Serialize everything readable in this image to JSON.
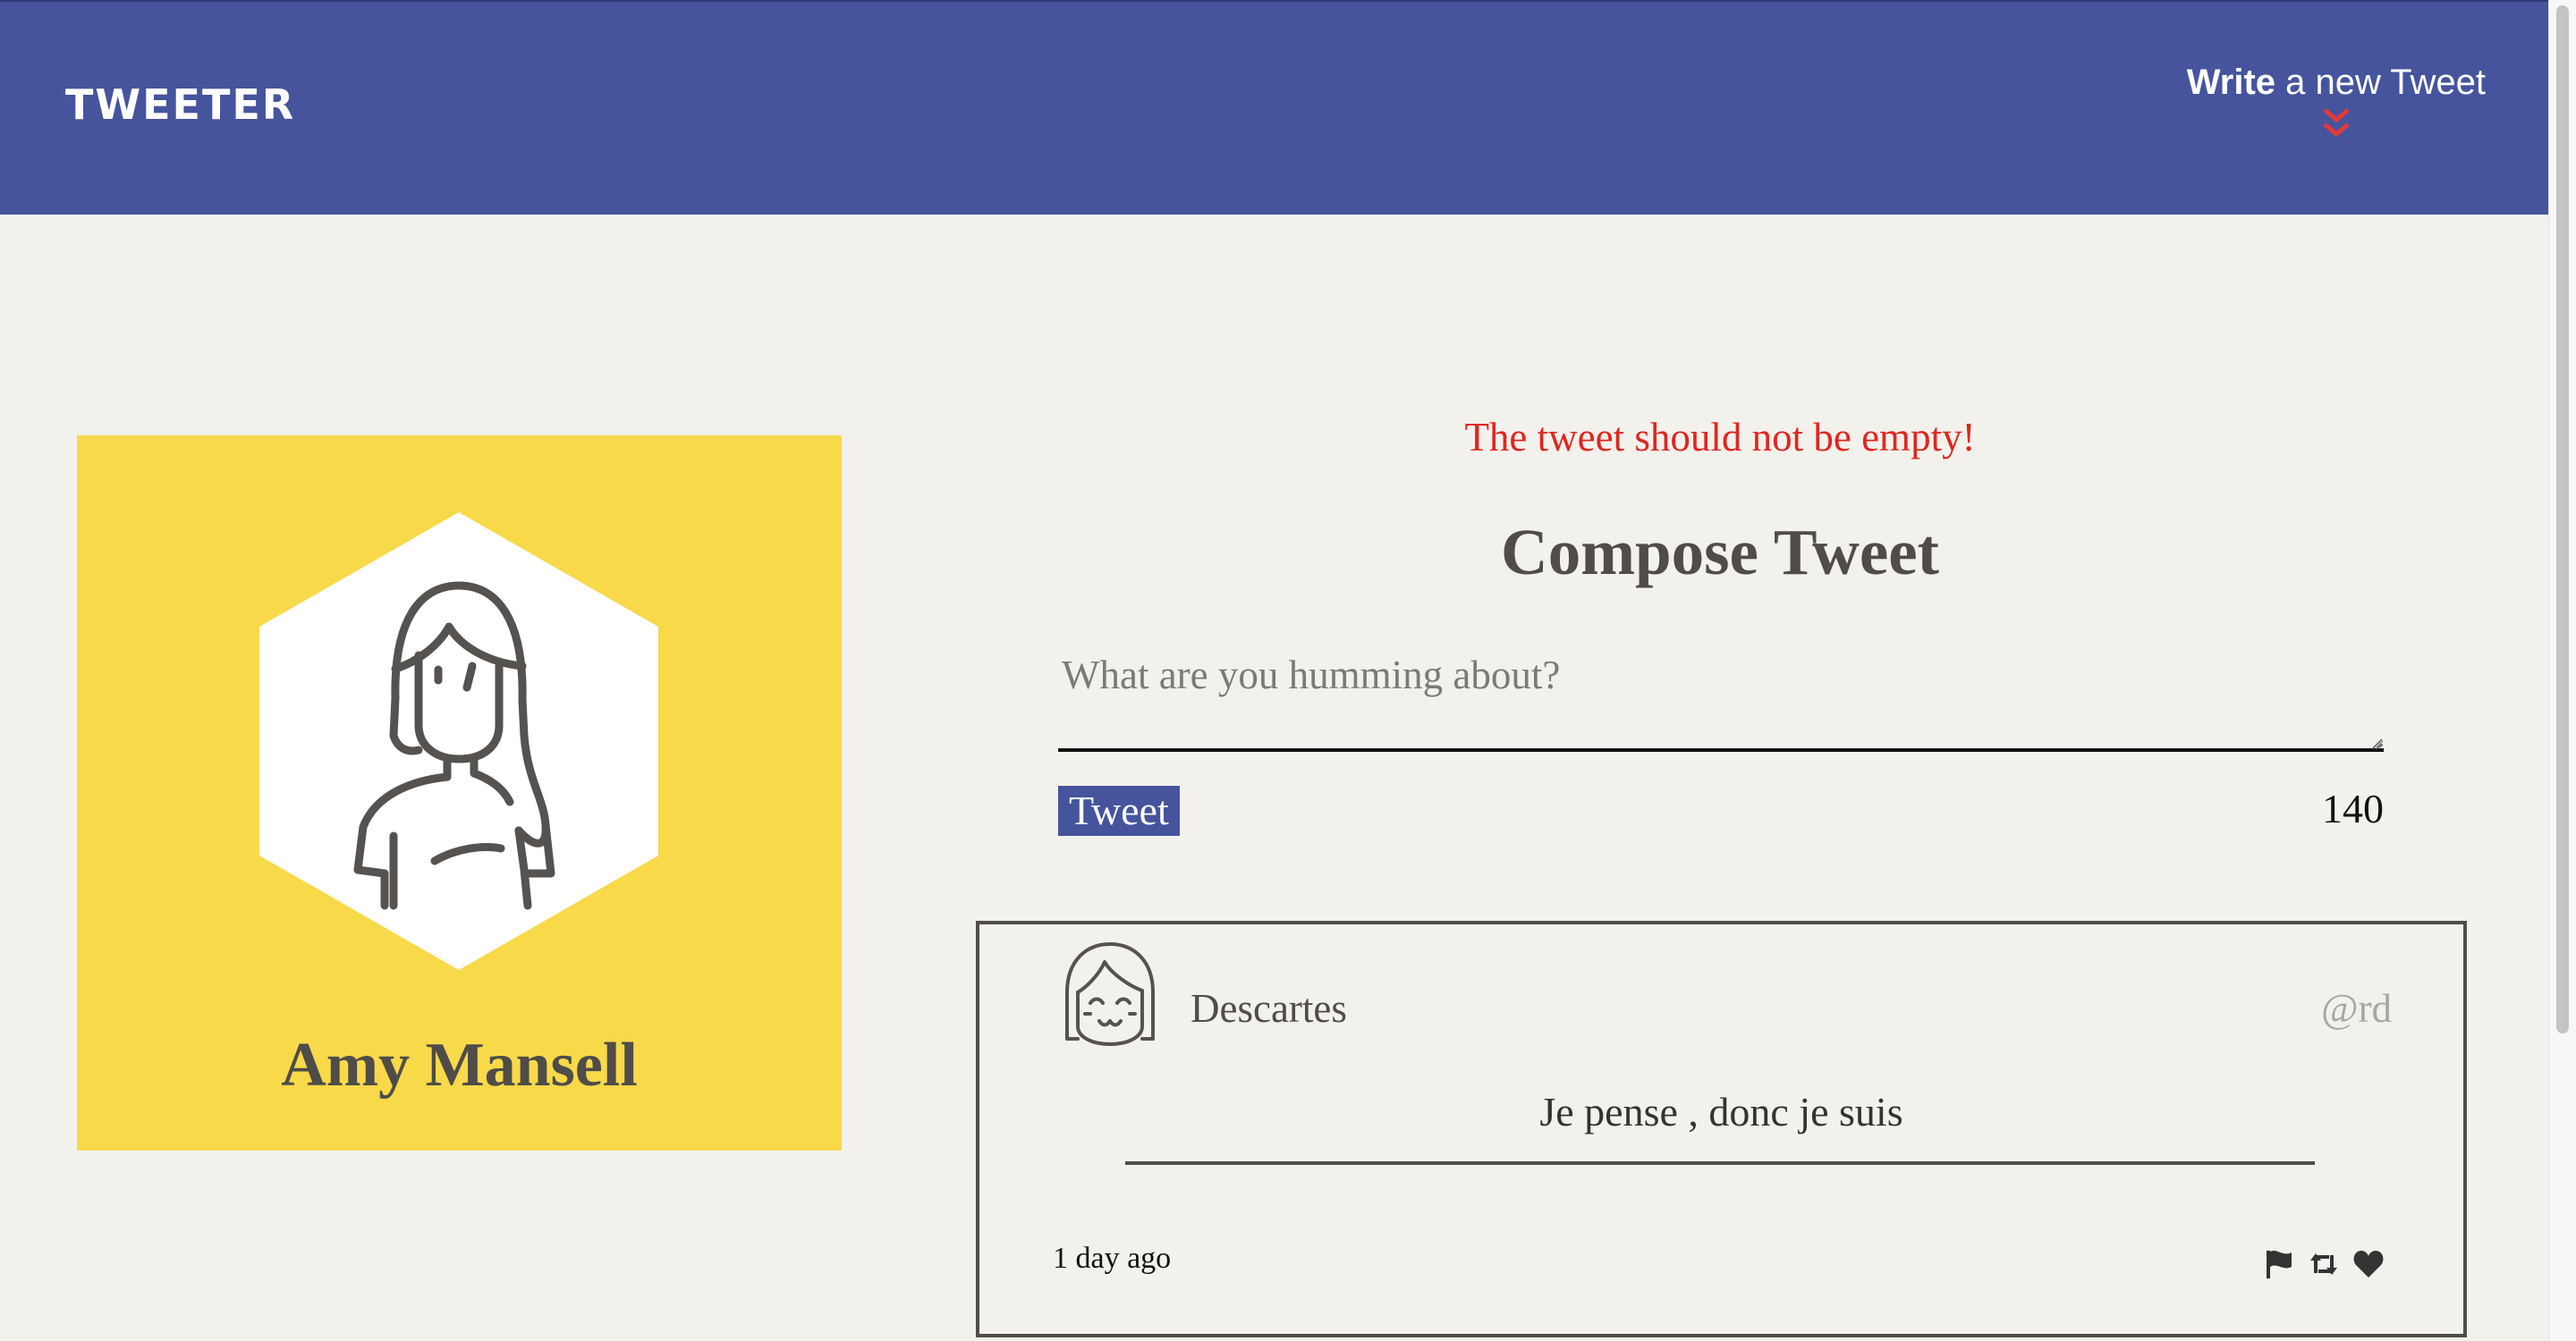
{
  "nav": {
    "brand": "TWEETER",
    "compose_bold": "Write",
    "compose_rest": " a new Tweet"
  },
  "profile": {
    "name": "Amy Mansell",
    "background_color": "#f8d94a",
    "avatar_icon": "woman-avatar-icon"
  },
  "compose": {
    "error": "The tweet should not be empty!",
    "title": "Compose Tweet",
    "placeholder": "What are you humming about?",
    "value": "",
    "button_label": "Tweet",
    "char_counter": "140"
  },
  "tweets": [
    {
      "name": "Descartes",
      "handle": "@rd",
      "content": "Je pense , donc je suis",
      "time": "1 day ago",
      "avatar_icon": "smiling-girl-avatar-icon",
      "actions": [
        "flag-icon",
        "retweet-icon",
        "heart-icon"
      ]
    }
  ],
  "colors": {
    "nav": "#45549c",
    "page_bg": "#f3f1ec",
    "error": "#e0261f",
    "accent_chevron": "#e33a3a",
    "text": "#4f4c49"
  }
}
